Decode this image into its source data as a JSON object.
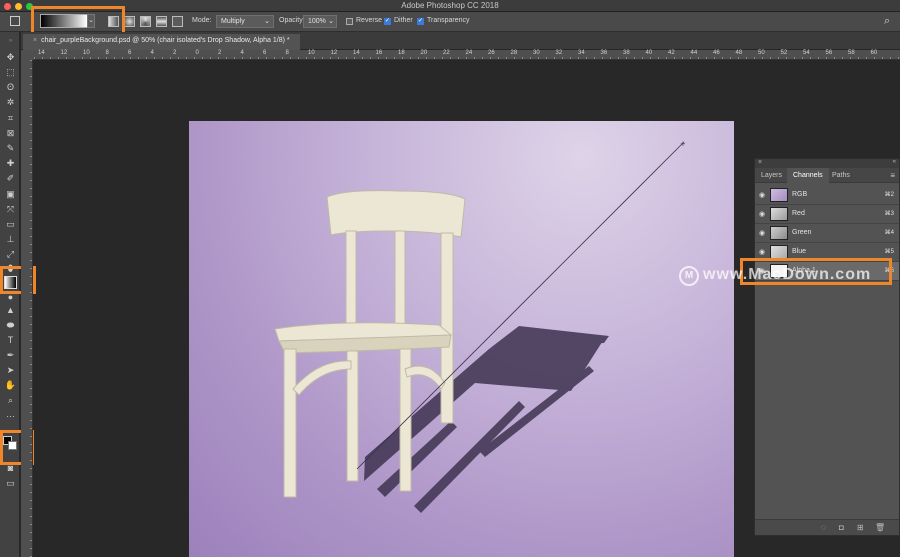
{
  "app": {
    "title": "Adobe Photoshop CC 2018",
    "traffic_lights": [
      "#ff5f57",
      "#febc2e",
      "#28c840"
    ]
  },
  "options": {
    "mode_label": "Mode:",
    "mode_value": "Multiply",
    "opacity_label": "Opacity:",
    "opacity_value": "100%",
    "reverse_label": "Reverse",
    "reverse_checked": false,
    "dither_label": "Dither",
    "dither_checked": true,
    "transparency_label": "Transparency",
    "transparency_checked": true
  },
  "document": {
    "tab_title": "chair_purpleBackground.psd @ 50% (chair isolated's Drop Shadow, Alpha 1/8) *"
  },
  "ruler": {
    "ticks": [
      "14",
      "12",
      "10",
      "8",
      "6",
      "4",
      "2",
      "0",
      "2",
      "4",
      "6",
      "8",
      "10",
      "12",
      "14",
      "16",
      "18",
      "20",
      "22",
      "24",
      "26",
      "28",
      "30",
      "32",
      "34",
      "36",
      "38",
      "40",
      "42",
      "44",
      "46",
      "48",
      "50",
      "52",
      "54",
      "56",
      "58",
      "60"
    ]
  },
  "panel": {
    "tabs": [
      "Layers",
      "Channels",
      "Paths"
    ],
    "active_tab": "Channels",
    "channels": [
      {
        "name": "RGB",
        "shortcut": "⌘2"
      },
      {
        "name": "Red",
        "shortcut": "⌘3"
      },
      {
        "name": "Green",
        "shortcut": "⌘4"
      },
      {
        "name": "Blue",
        "shortcut": "⌘5"
      },
      {
        "name": "Alpha 1",
        "shortcut": "⌘6"
      }
    ]
  },
  "watermark": {
    "text": "www.MacDown.com"
  },
  "colors": {
    "highlight": "#f0862a",
    "canvas_bg": "#b49cca"
  }
}
